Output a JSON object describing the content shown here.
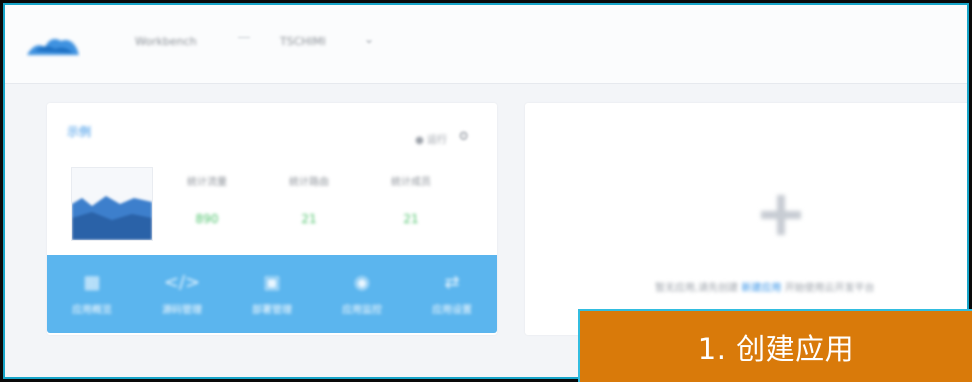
{
  "topbar": {
    "logo": "cloud-logo-icon",
    "breadcrumb": [
      "Workbench",
      "TSCHIMI"
    ],
    "chevron": "chevron-down-icon"
  },
  "app_card": {
    "title": "示例",
    "meta": "● 运行",
    "meta_icon": "gear-icon",
    "stats": [
      {
        "label": "统计流量",
        "value": "890"
      },
      {
        "label": "统计路由",
        "value": "21"
      },
      {
        "label": "统计成员",
        "value": "21"
      }
    ],
    "actions": [
      {
        "icon": "dashboard-icon",
        "label": "应用概览"
      },
      {
        "icon": "code-icon",
        "label": "源码管理"
      },
      {
        "icon": "deploy-icon",
        "label": "部署管理"
      },
      {
        "icon": "monitor-icon",
        "label": "应用监控"
      },
      {
        "icon": "settings-icon",
        "label": "应用设置"
      }
    ]
  },
  "create_card": {
    "hint_prefix": "暂无应用,请先创建",
    "hint_link": "新建应用",
    "hint_suffix": "开始使用云开发平台"
  },
  "callout": {
    "text": "1. 创建应用"
  },
  "colors": {
    "accent_blue": "#5bb5ee",
    "link_blue": "#2f8fe6",
    "callout_orange": "#d97a0a",
    "frame_cyan": "#17a5c9",
    "stat_green": "#4cc26a"
  }
}
